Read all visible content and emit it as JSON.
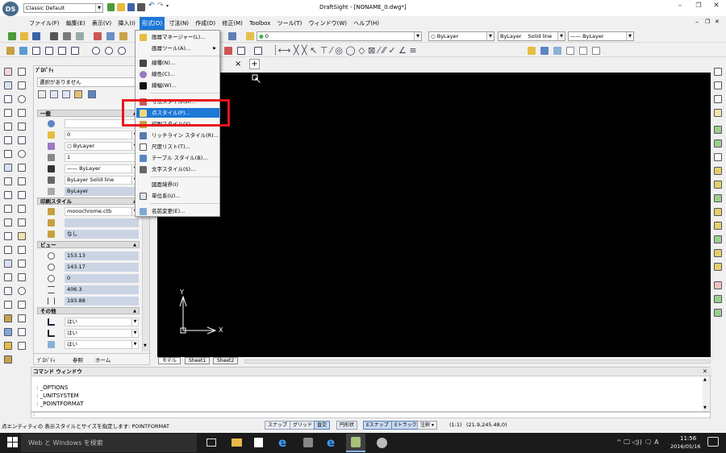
{
  "window": {
    "title": "DraftSight - [NONAME_0.dwg*]",
    "workspace": "Classic Default",
    "minimize": "–",
    "restore": "❐",
    "close": "✕",
    "doc_minimize": "–",
    "doc_restore": "❐",
    "doc_close": "✕"
  },
  "menubar": [
    "ファイル(F)",
    "編集(E)",
    "表示(V)",
    "挿入(I)",
    "形式(O)",
    "寸法(N)",
    "作成(D)",
    "修正(M)",
    "Toolbox",
    "ツール(T)",
    "ウィンドウ(W)",
    "ヘルプ(H)"
  ],
  "active_menu": "形式(O)",
  "format_menu": {
    "items": [
      {
        "label": "画層マネージャー(L)...",
        "icon": "layers-manager-icon"
      },
      {
        "label": "画層ツール(A)...",
        "icon": "none",
        "submenu": "▶"
      },
      {
        "label": "線種(N)...",
        "icon": "linetype-icon"
      },
      {
        "label": "線色(C)...",
        "icon": "color-icon"
      },
      {
        "label": "線幅(W)...",
        "icon": "lineweight-icon"
      },
      {
        "label": "寸法スタイル(D)...",
        "icon": "dimension-style-icon"
      },
      {
        "label": "点スタイル(P)...",
        "icon": "point-style-icon"
      },
      {
        "label": "印刷スタイル(Y)...",
        "icon": "print-style-icon"
      },
      {
        "label": "リッチライン スタイル(R)...",
        "icon": "richline-style-icon"
      },
      {
        "label": "尺度リスト(T)...",
        "icon": "scale-list-icon"
      },
      {
        "label": "テーブル スタイル(B)...",
        "icon": "table-style-icon"
      },
      {
        "label": "文字スタイル(S)...",
        "icon": "text-style-icon"
      },
      {
        "label": "図面境界(I)",
        "icon": "none"
      },
      {
        "label": "単位系(U)...",
        "icon": "units-icon"
      },
      {
        "label": "名前変更(E)...",
        "icon": "rename-icon"
      }
    ],
    "highlighted": "点スタイル(P)..."
  },
  "toolbar": {
    "layer_value": "0",
    "color_combo": "ByLayer",
    "linestyle_combo": "ByLayer",
    "linestyle_name": "Solid line",
    "lineweight_combo": "—— ByLayer"
  },
  "properties": {
    "title": "ﾌﾟﾛﾊﾟﾃｨ",
    "selection": "選択がありません",
    "sections": {
      "general": "一般",
      "print_style": "印刷スタイル",
      "view": "ビュー",
      "other": "その他"
    },
    "general_rows": [
      "",
      "0",
      "○ ByLayer",
      "1",
      "—— ByLayer",
      "ByLayer      Solid line",
      "ByLayer"
    ],
    "print_rows": [
      "monochrome.ctb",
      "",
      "なし"
    ],
    "view_rows": [
      "153.13",
      "143.17",
      "0",
      "406.3",
      "193.88"
    ],
    "other_rows": [
      "はい",
      "はい",
      "はい"
    ],
    "tabs": [
      "ﾌﾟﾛﾊﾟﾃｨ",
      "参照",
      "ホーム"
    ]
  },
  "drawing": {
    "tab_close": "×",
    "tab_add": "+",
    "axis_y": "Y",
    "axis_x": "X",
    "layout_tabs": [
      "モデル",
      "Sheet1",
      "Sheet2"
    ]
  },
  "command": {
    "title": "コマンド ウィンドウ",
    "close": "✕",
    "lines": [
      ": _OPTIONS",
      ": _UNITSYSTEM",
      ": _POINTFORMAT"
    ],
    "prompt": ":"
  },
  "statusbar": {
    "hint": "点エンティティの 表示スタイルとサイズを指定します: POINTFORMAT",
    "buttons": [
      {
        "label": "スナップ",
        "on": false
      },
      {
        "label": "グリッド",
        "on": false
      },
      {
        "label": "直交",
        "on": true
      },
      {
        "label": "円形状",
        "on": false
      },
      {
        "label": "Eスナップ",
        "on": true
      },
      {
        "label": "Eトラック",
        "on": true
      }
    ],
    "annotation": "注釈 ▾",
    "scale": "(1:1)",
    "coords": "(21.9,245.48,0)"
  },
  "taskbar": {
    "search": "Web と Windows を検索",
    "time": "11:56",
    "date": "2016/05/16",
    "tray": "^ 🖵 ◁)) 🗨 A"
  },
  "colors": {
    "highlight": "#1e78d7",
    "callout": "#e8141c",
    "canvas": "#000000",
    "axis": "#ffffff"
  }
}
